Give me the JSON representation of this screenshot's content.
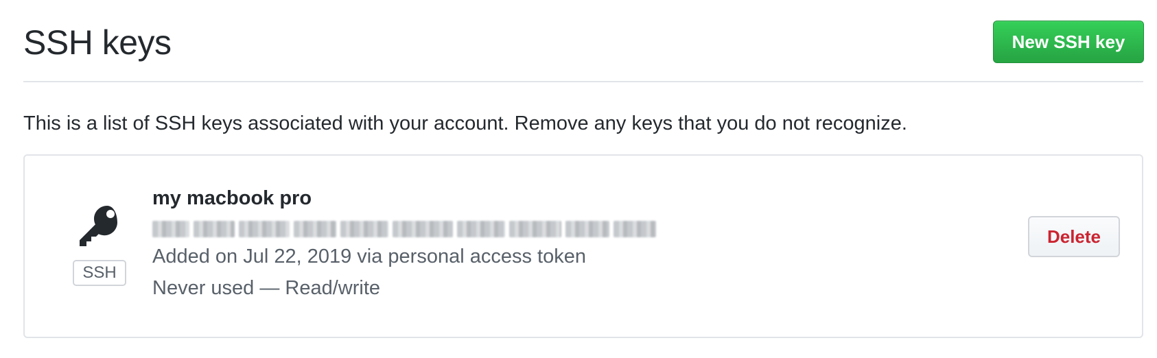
{
  "header": {
    "title": "SSH keys",
    "new_key_label": "New SSH key"
  },
  "intro": "This is a list of SSH keys associated with your account. Remove any keys that you do not recognize.",
  "keys": [
    {
      "icon": "key-icon",
      "type_label": "SSH",
      "title": "my macbook pro",
      "fingerprint": "",
      "added": "Added on Jul 22, 2019 via personal access token",
      "usage": "Never used — Read/write",
      "delete_label": "Delete"
    }
  ],
  "colors": {
    "primary_button": "#28a745",
    "danger_text": "#cb2431",
    "muted_text": "#586069",
    "border": "#e1e4e8"
  }
}
